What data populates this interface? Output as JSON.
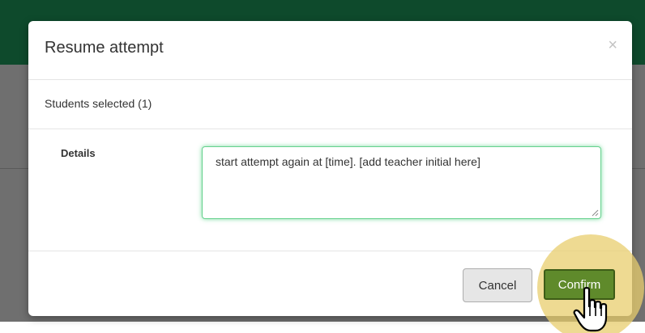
{
  "modal": {
    "title": "Resume attempt",
    "close_label": "×",
    "students_selected": "Students selected (1)",
    "details_label": "Details",
    "details_value": "start attempt again at [time]. [add teacher initial here]",
    "cancel_label": "Cancel",
    "confirm_label": "Confirm"
  },
  "colors": {
    "topbar": "#0e4a2c",
    "confirm": "#5f8a2b",
    "highlight": "#e8cd6e",
    "focus_glow": "#66d18e"
  },
  "icons": {
    "close": "close-icon",
    "cursor": "hand-pointer-icon",
    "resize": "resize-grip-icon"
  }
}
